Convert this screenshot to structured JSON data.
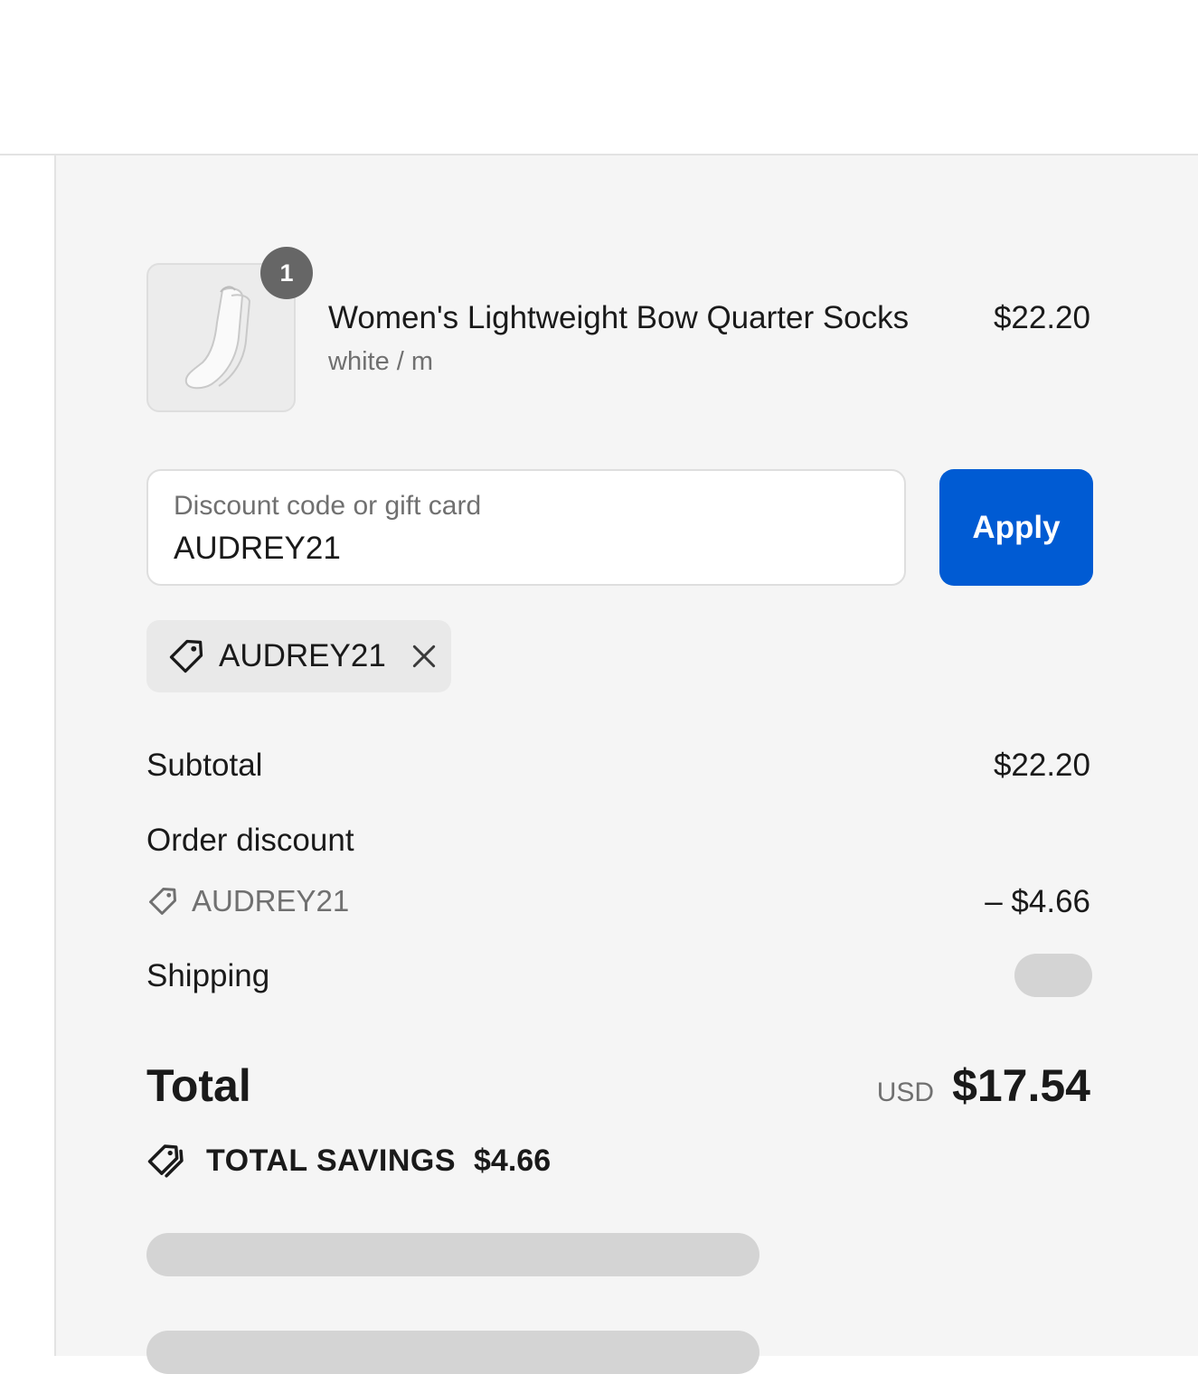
{
  "cart_item": {
    "quantity": "1",
    "name": "Women's Lightweight Bow Quarter Socks",
    "variant": "white / m",
    "price": "$22.20"
  },
  "discount": {
    "placeholder": "Discount code or gift card",
    "value": "AUDREY21",
    "apply_label": "Apply",
    "applied_code": "AUDREY21"
  },
  "totals": {
    "subtotal_label": "Subtotal",
    "subtotal_value": "$22.20",
    "order_discount_label": "Order discount",
    "order_discount_code": "AUDREY21",
    "order_discount_value": "– $4.66",
    "shipping_label": "Shipping",
    "total_label": "Total",
    "currency": "USD",
    "total_value": "$17.54",
    "savings_label": "TOTAL SAVINGS",
    "savings_value": "$4.66"
  },
  "colors": {
    "accent": "#005bd3",
    "panel_bg": "#f5f5f5",
    "muted_text": "#707070"
  }
}
